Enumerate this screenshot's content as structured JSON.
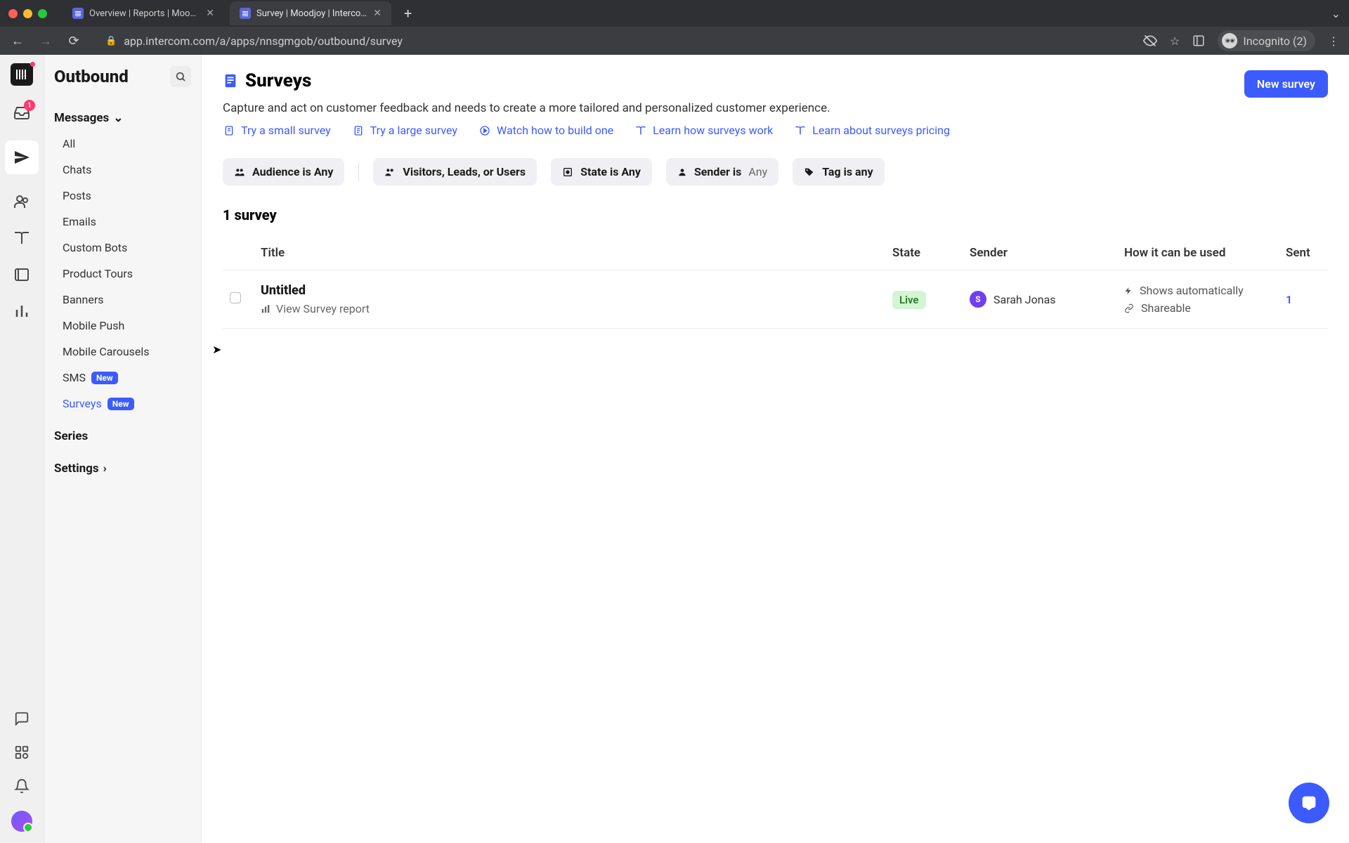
{
  "browser": {
    "tabs": [
      {
        "title": "Overview | Reports | Moodjoy",
        "active": false
      },
      {
        "title": "Survey | Moodjoy | Intercom",
        "active": true
      }
    ],
    "url": "app.intercom.com/a/apps/nnsgmgob/outbound/survey",
    "incognito_label": "Incognito (2)"
  },
  "rail": {
    "inbox_badge": "1"
  },
  "sidebar": {
    "title": "Outbound",
    "groups": {
      "messages": {
        "label": "Messages",
        "items": {
          "all": "All",
          "chats": "Chats",
          "posts": "Posts",
          "emails": "Emails",
          "custom_bots": "Custom Bots",
          "product_tours": "Product Tours",
          "banners": "Banners",
          "mobile_push": "Mobile Push",
          "mobile_carousels": "Mobile Carousels",
          "sms": "SMS",
          "surveys": "Surveys",
          "new_badge": "New"
        }
      },
      "series": {
        "label": "Series"
      },
      "settings": {
        "label": "Settings"
      }
    }
  },
  "page": {
    "title": "Surveys",
    "subtitle": "Capture and act on customer feedback and needs to create a more tailored and personalized customer experience.",
    "new_button": "New survey",
    "help_links": {
      "try_small": "Try a small survey",
      "try_large": "Try a large survey",
      "watch": "Watch how to build one",
      "learn_how": "Learn how surveys work",
      "learn_pricing": "Learn about surveys pricing"
    },
    "filters": {
      "audience": "Audience is Any",
      "visitors": "Visitors, Leads, or Users",
      "state": "State is Any",
      "sender_label": "Sender is",
      "sender_value": "Any",
      "tag": "Tag is any"
    },
    "count": "1 survey",
    "columns": {
      "title": "Title",
      "state": "State",
      "sender": "Sender",
      "usage": "How it can be used",
      "sent": "Sent"
    },
    "rows": [
      {
        "title": "Untitled",
        "report_link": "View Survey report",
        "state": "Live",
        "sender": "Sarah Jonas",
        "usage_auto": "Shows automatically",
        "usage_share": "Shareable",
        "sent": "1"
      }
    ]
  }
}
